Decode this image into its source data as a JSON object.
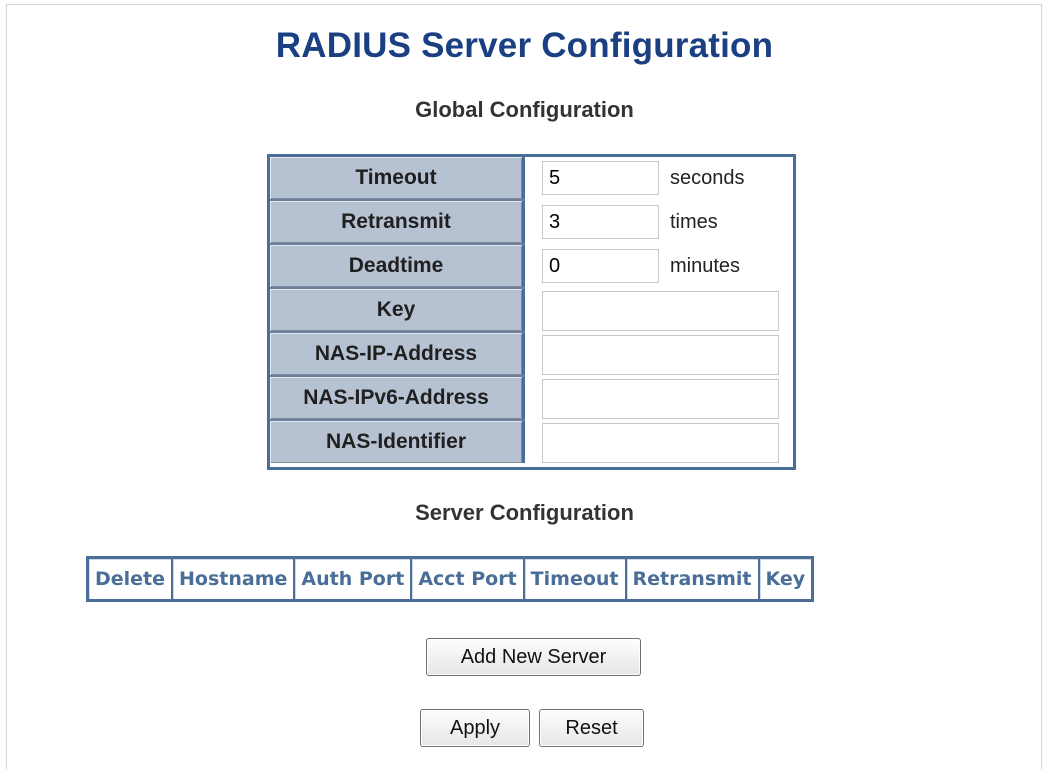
{
  "page": {
    "title": "RADIUS Server Configuration",
    "global_heading": "Global Configuration",
    "server_heading": "Server Configuration"
  },
  "global": {
    "rows": [
      {
        "label": "Timeout",
        "value": "5",
        "unit": "seconds"
      },
      {
        "label": "Retransmit",
        "value": "3",
        "unit": "times"
      },
      {
        "label": "Deadtime",
        "value": "0",
        "unit": "minutes"
      },
      {
        "label": "Key",
        "value": ""
      },
      {
        "label": "NAS-IP-Address",
        "value": ""
      },
      {
        "label": "NAS-IPv6-Address",
        "value": ""
      },
      {
        "label": "NAS-Identifier",
        "value": ""
      }
    ]
  },
  "server_table": {
    "columns": [
      "Delete",
      "Hostname",
      "Auth Port",
      "Acct Port",
      "Timeout",
      "Retransmit",
      "Key"
    ]
  },
  "buttons": {
    "add_new_server": "Add New Server",
    "apply": "Apply",
    "reset": "Reset"
  },
  "colors": {
    "title": "#1a3f82",
    "table_border": "#4a6e98",
    "label_bg": "#b6c2d2"
  }
}
